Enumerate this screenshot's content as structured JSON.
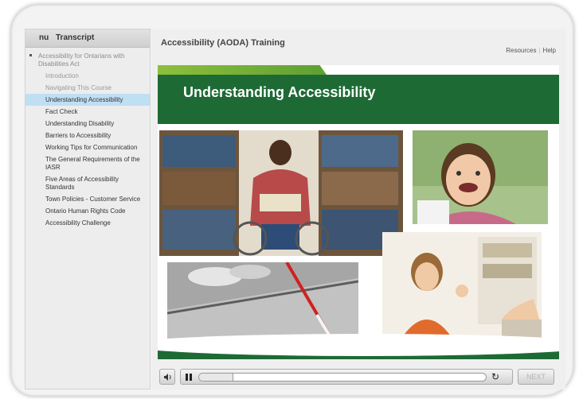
{
  "sidebar": {
    "tabs": [
      {
        "label": "nu"
      },
      {
        "label": "Transcript"
      }
    ],
    "items": [
      {
        "label": "Accessibility for Ontarians with Disabilities Act"
      },
      {
        "label": "Introduction"
      },
      {
        "label": "Navigating This Course"
      },
      {
        "label": "Understanding Accessibility"
      },
      {
        "label": "Fact Check"
      },
      {
        "label": "Understanding Disability"
      },
      {
        "label": "Barriers to Accessibility"
      },
      {
        "label": "Working Tips for Communication"
      },
      {
        "label": "The General Requirements of the IASR"
      },
      {
        "label": "Five Areas of Accessibility Standards"
      },
      {
        "label": "Town Policies - Customer Service"
      },
      {
        "label": "Ontario Human Rights Code"
      },
      {
        "label": "Accessibility Challenge"
      }
    ],
    "active_index": 3
  },
  "header": {
    "title": "Accessibility (AODA) Training",
    "links": [
      {
        "label": "Resources"
      },
      {
        "label": "Help"
      }
    ]
  },
  "slide": {
    "heading": "Understanding Accessibility"
  },
  "player": {
    "next_label": "NEXT",
    "progress": 0.12
  },
  "colors": {
    "banner_green": "#1e6a35",
    "accent_green": "#8dbf3c",
    "active_item": "#bfdff3"
  },
  "icons": {
    "mute": "speaker-icon",
    "pause": "pause-icon",
    "replay": "replay-icon"
  }
}
